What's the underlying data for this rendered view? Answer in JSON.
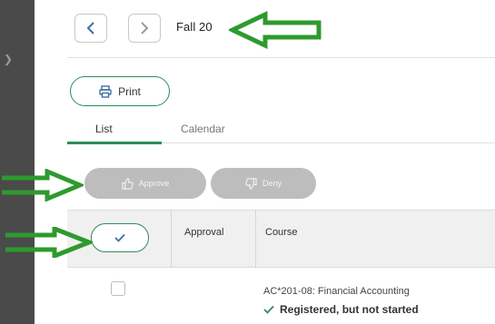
{
  "term": {
    "title": "Fall 20"
  },
  "toolbar": {
    "print_label": "Print"
  },
  "tabs": [
    {
      "label": "List",
      "active": true
    },
    {
      "label": "Calendar",
      "active": false
    }
  ],
  "actions": {
    "approve_label": "Approve",
    "deny_label": "Deny"
  },
  "table": {
    "headers": {
      "approval": "Approval",
      "course": "Course"
    },
    "rows": [
      {
        "course": "AC*201-08: Financial Accounting",
        "status": "Registered, but not started",
        "checked": false
      }
    ]
  },
  "icons": {
    "prev": "chevron-left-icon",
    "next": "chevron-right-icon",
    "print": "printer-icon",
    "approve": "thumbs-up-icon",
    "deny": "thumbs-down-icon",
    "select_all": "checkmark-icon",
    "status": "checkmark-icon"
  },
  "colors": {
    "accent": "#2e8b57",
    "annotation_arrow": "#2e9a2e",
    "nav_chevron": "#3d6ea8",
    "disabled_button": "#bdbdbd",
    "left_rail": "#4a4a4a"
  }
}
